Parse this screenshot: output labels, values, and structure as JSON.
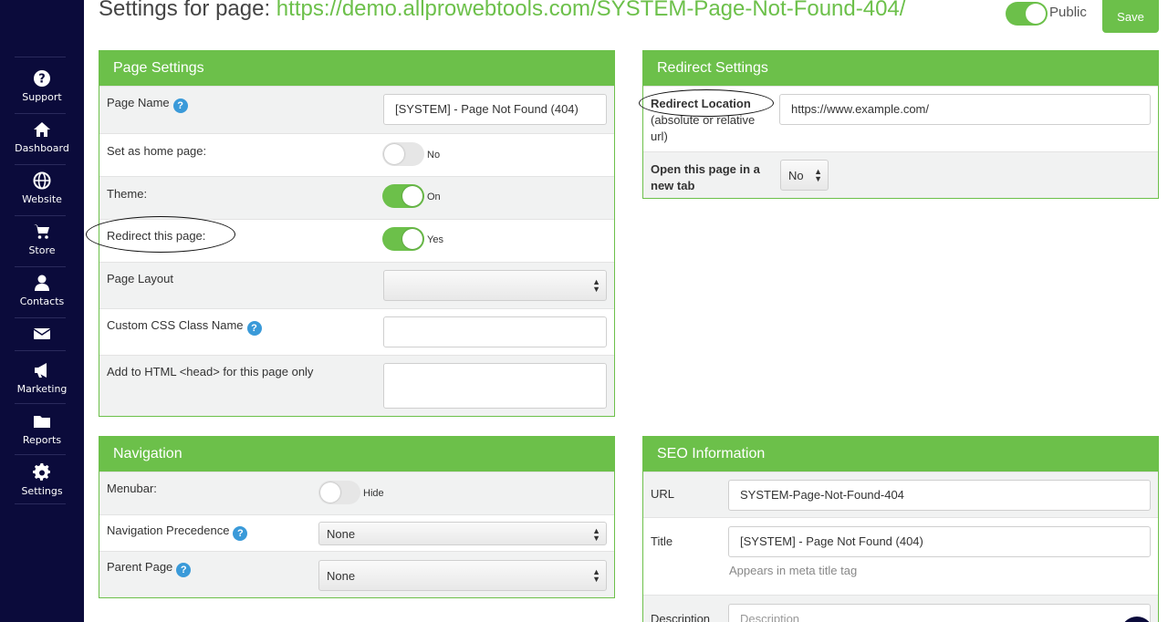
{
  "sidebar": {
    "items": [
      {
        "label": "Support",
        "icon": "question-circle-icon"
      },
      {
        "label": "Dashboard",
        "icon": "home-icon"
      },
      {
        "label": "Website",
        "icon": "globe-icon"
      },
      {
        "label": "Store",
        "icon": "cart-icon"
      },
      {
        "label": "Contacts",
        "icon": "user-icon"
      },
      {
        "label": "",
        "icon": "envelope-icon"
      },
      {
        "label": "Marketing",
        "icon": "megaphone-icon"
      },
      {
        "label": "Reports",
        "icon": "folder-icon"
      },
      {
        "label": "Settings",
        "icon": "gear-icon"
      }
    ]
  },
  "header": {
    "title_prefix": "Settings for page: ",
    "title_url": "https://demo.allprowebtools.com/SYSTEM-Page-Not-Found-404/",
    "public_label": "Public",
    "public_on": true,
    "save_label": "Save"
  },
  "page_settings": {
    "title": "Page Settings",
    "page_name_label": "Page Name",
    "page_name_value": "[SYSTEM] - Page Not Found (404)",
    "home_label": "Set as home page:",
    "home_state": "No",
    "theme_label": "Theme:",
    "theme_state": "On",
    "redirect_label": "Redirect this page:",
    "redirect_state": "Yes",
    "layout_label": "Page Layout",
    "layout_value": "",
    "css_label": "Custom CSS Class Name",
    "css_value": "",
    "head_label": "Add to HTML <head> for this page only"
  },
  "redirect_settings": {
    "title": "Redirect Settings",
    "location_label": "Redirect Location",
    "location_sub": "(absolute or relative url)",
    "location_value": "https://www.example.com/",
    "newtab_label": "Open this page in a new tab",
    "newtab_value": "No"
  },
  "navigation": {
    "title": "Navigation",
    "menubar_label": "Menubar:",
    "menubar_state": "Hide",
    "precedence_label": "Navigation Precedence",
    "precedence_value": "None",
    "parent_label": "Parent Page",
    "parent_value": "None"
  },
  "seo": {
    "title": "SEO Information",
    "url_label": "URL",
    "url_value": "SYSTEM-Page-Not-Found-404",
    "title_label": "Title",
    "title_value": "[SYSTEM] - Page Not Found (404)",
    "title_hint": "Appears in meta title tag",
    "desc_label": "Description",
    "desc_placeholder": "Description"
  }
}
